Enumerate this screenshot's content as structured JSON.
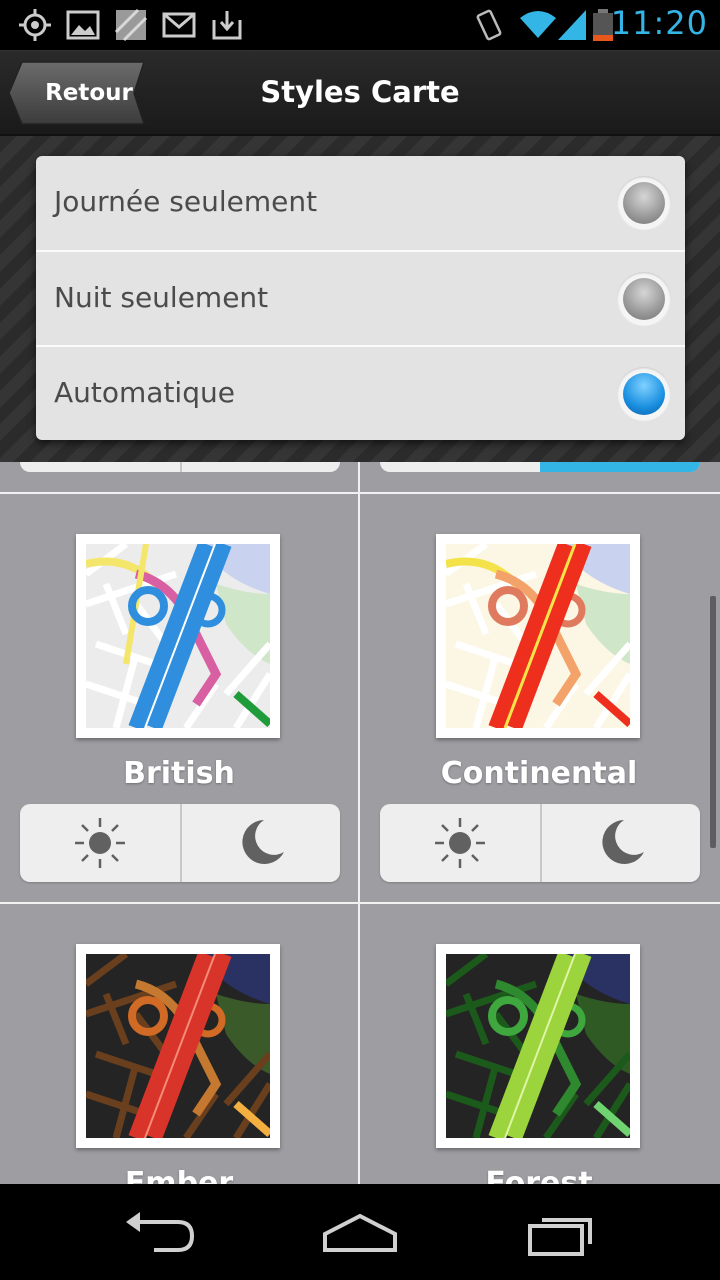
{
  "status_bar": {
    "time": "11:20",
    "icons": [
      "gps-icon",
      "gallery-icon",
      "maps-icon",
      "gmail-icon",
      "download-icon",
      "vibrate-icon",
      "wifi-icon",
      "signal-icon",
      "battery-icon"
    ],
    "accent_color": "#33b5e5"
  },
  "title_bar": {
    "back_label": "Retour",
    "title": "Styles Carte"
  },
  "popup": {
    "options": [
      {
        "label": "Journée seulement",
        "selected": false
      },
      {
        "label": "Nuit seulement",
        "selected": false
      },
      {
        "label": "Automatique",
        "selected": true
      }
    ]
  },
  "styles": [
    {
      "name": "British",
      "icons": [
        "sun-icon",
        "moon-icon"
      ]
    },
    {
      "name": "Continental",
      "icons": [
        "sun-icon",
        "moon-icon"
      ]
    },
    {
      "name": "Ember"
    },
    {
      "name": "Forest"
    }
  ],
  "nav_bar": {
    "icons": [
      "back-icon",
      "home-icon",
      "recent-apps-icon"
    ]
  },
  "colors": {
    "content_bg": "#9e9da2",
    "selected_radio": "#1a8fe0"
  }
}
